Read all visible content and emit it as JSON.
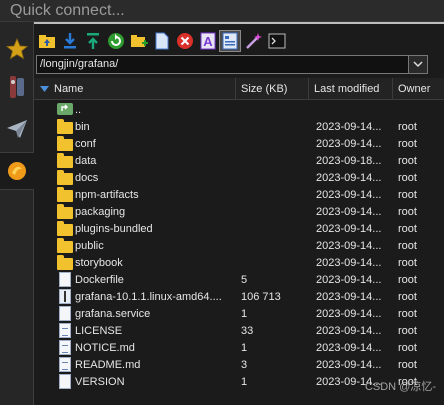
{
  "quick_connect": {
    "placeholder": "Quick connect..."
  },
  "path": {
    "value": "/longjin/grafana/"
  },
  "columns": {
    "name": "Name",
    "size": "Size (KB)",
    "modified": "Last modified",
    "owner": "Owner"
  },
  "parent": {
    "label": ".."
  },
  "files": [
    {
      "name": "bin",
      "size": "",
      "modified": "2023-09-14...",
      "owner": "root",
      "kind": "folder"
    },
    {
      "name": "conf",
      "size": "",
      "modified": "2023-09-14...",
      "owner": "root",
      "kind": "folder"
    },
    {
      "name": "data",
      "size": "",
      "modified": "2023-09-18...",
      "owner": "root",
      "kind": "folder"
    },
    {
      "name": "docs",
      "size": "",
      "modified": "2023-09-14...",
      "owner": "root",
      "kind": "folder"
    },
    {
      "name": "npm-artifacts",
      "size": "",
      "modified": "2023-09-14...",
      "owner": "root",
      "kind": "folder"
    },
    {
      "name": "packaging",
      "size": "",
      "modified": "2023-09-14...",
      "owner": "root",
      "kind": "folder"
    },
    {
      "name": "plugins-bundled",
      "size": "",
      "modified": "2023-09-14...",
      "owner": "root",
      "kind": "folder"
    },
    {
      "name": "public",
      "size": "",
      "modified": "2023-09-14...",
      "owner": "root",
      "kind": "folder"
    },
    {
      "name": "storybook",
      "size": "",
      "modified": "2023-09-14...",
      "owner": "root",
      "kind": "folder"
    },
    {
      "name": "Dockerfile",
      "size": "5",
      "modified": "2023-09-14...",
      "owner": "root",
      "kind": "file"
    },
    {
      "name": "grafana-10.1.1.linux-amd64....",
      "size": "106 713",
      "modified": "2023-09-14...",
      "owner": "root",
      "kind": "archive"
    },
    {
      "name": "grafana.service",
      "size": "1",
      "modified": "2023-09-14...",
      "owner": "root",
      "kind": "file"
    },
    {
      "name": "LICENSE",
      "size": "33",
      "modified": "2023-09-14...",
      "owner": "root",
      "kind": "text"
    },
    {
      "name": "NOTICE.md",
      "size": "1",
      "modified": "2023-09-14...",
      "owner": "root",
      "kind": "text"
    },
    {
      "name": "README.md",
      "size": "3",
      "modified": "2023-09-14...",
      "owner": "root",
      "kind": "text"
    },
    {
      "name": "VERSION",
      "size": "1",
      "modified": "2023-09-14...",
      "owner": "root",
      "kind": "file"
    }
  ],
  "watermark": "CSDN @凉忆-",
  "colors": {
    "folder": "#f2c12e",
    "accent": "#4a8fd9",
    "background": "#1b1b1b"
  }
}
